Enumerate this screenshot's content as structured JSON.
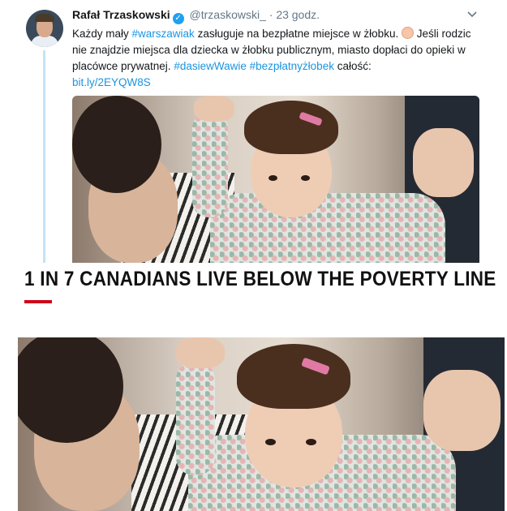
{
  "tweet": {
    "author_name": "Rafał Trzaskowski",
    "handle": "@trzaskowski_",
    "separator": "·",
    "time": "23 godz.",
    "verified_glyph": "✓",
    "text_part1": "Każdy mały ",
    "hashtag1": "#warszawiak",
    "text_part2": " zasługuje na bezpłatne miejsce w żłobku. ",
    "text_part3": " Jeśli rodzic nie znajdzie miejsca dla dziecka w żłobku publicznym, miasto dopłaci do opieki w placówce prywatnej. ",
    "hashtag2": "#dasiewWawie",
    "hashtag3": "#bezpłatnyżłobek",
    "text_part4": " całość:",
    "link": "bit.ly/2EYQW8S",
    "icons": {
      "verified": "verified-badge-icon",
      "menu": "chevron-down-icon",
      "emoji": "baby-emoji-icon"
    },
    "colors": {
      "hashtag": "#1b95e0",
      "verified": "#1da1f2",
      "thread_line": "#c4e3f5"
    }
  },
  "article": {
    "headline": "1 IN 7 CANADIANS LIVE BELOW THE POVERTY LINE",
    "accent_color": "#d0021b"
  }
}
